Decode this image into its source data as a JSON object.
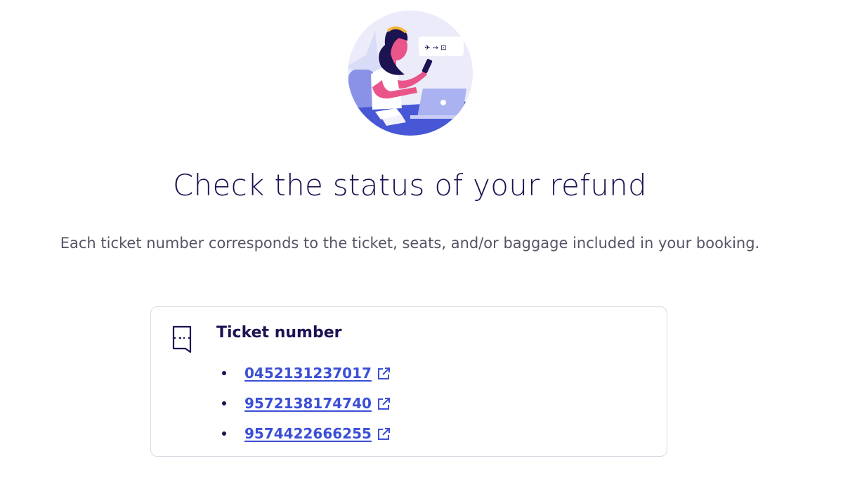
{
  "header": {
    "title": "Check the status of your refund",
    "description": "Each ticket number corresponds to the ticket, seats, and/or baggage included in your booking."
  },
  "ticket_card": {
    "icon": "ticket-icon",
    "heading": "Ticket number",
    "tickets": [
      {
        "number": "0452131237017",
        "icon": "external-link-icon"
      },
      {
        "number": "9572138174740",
        "icon": "external-link-icon"
      },
      {
        "number": "9574422666255",
        "icon": "external-link-icon"
      }
    ]
  },
  "colors": {
    "title": "#1b1352",
    "link": "#3b4fd6",
    "accent_blue": "#4757d6",
    "border": "#d9d9e3"
  }
}
